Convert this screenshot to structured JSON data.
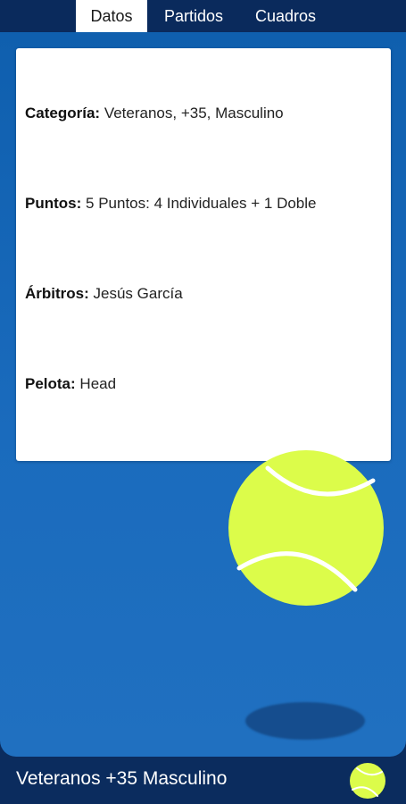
{
  "tabs": [
    {
      "label": "Datos",
      "active": true
    },
    {
      "label": "Partidos",
      "active": false
    },
    {
      "label": "Cuadros",
      "active": false
    }
  ],
  "details": {
    "categoria": {
      "label": "Categoría:",
      "value": "Veteranos, +35, Masculino"
    },
    "puntos": {
      "label": "Puntos:",
      "value": "5 Puntos: 4 Individuales + 1 Doble"
    },
    "arbitros": {
      "label": "Árbitros:",
      "value": "Jesús García"
    },
    "pelota": {
      "label": "Pelota:",
      "value": "Head"
    }
  },
  "footer": {
    "title": "Veteranos +35 Masculino",
    "icon": "tennis-ball-icon"
  },
  "colors": {
    "bar": "#0b2c5e",
    "panel": "#1a6bbd",
    "ball": "#dcfc4a",
    "active_tab_bg": "#ffffff"
  }
}
